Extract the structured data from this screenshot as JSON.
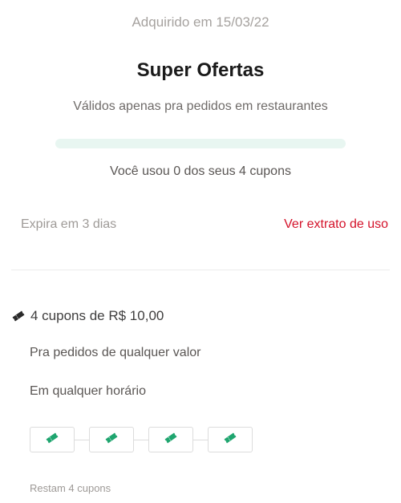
{
  "header": {
    "acquired_text": "Adquirido em 15/03/22",
    "title": "Super Ofertas",
    "subtitle": "Válidos apenas pra pedidos em restaurantes"
  },
  "progress": {
    "used": 0,
    "total": 4,
    "fraction": 0,
    "usage_text": "Você usou 0 dos seus 4 cupons",
    "track_color": "#e8f6f1",
    "fill_color": "#2dbe86"
  },
  "validity": {
    "expire_text": "Expira em 3 dias",
    "statement_link": "Ver extrato de uso",
    "link_color": "#d4122a"
  },
  "coupon": {
    "icon": "ticket-icon",
    "heading": "4 cupons de R$ 10,00",
    "conditions": [
      "Pra pedidos de qualquer valor",
      "Em qualquer horário"
    ],
    "slots": [
      {
        "icon": "ticket-icon",
        "used": false
      },
      {
        "icon": "ticket-icon",
        "used": false
      },
      {
        "icon": "ticket-icon",
        "used": false
      },
      {
        "icon": "ticket-icon",
        "used": false
      }
    ],
    "slot_icon_color": "#1fa56f",
    "remaining_text": "Restam 4 cupons"
  }
}
